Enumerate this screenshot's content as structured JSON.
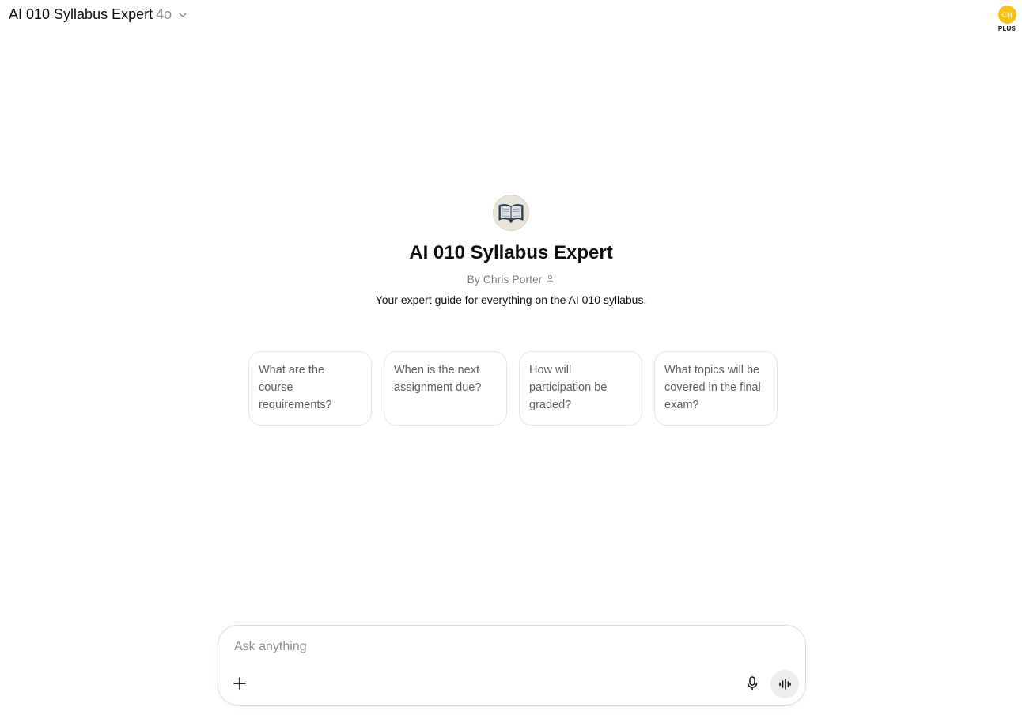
{
  "header": {
    "model_title": "AI 010 Syllabus Expert",
    "model_version": "4o",
    "chevron_icon": "chevron-down-icon",
    "account": {
      "initials": "CH",
      "plan": "PLUS",
      "avatar_color": "#f5c414"
    }
  },
  "intro": {
    "avatar_icon": "open-book-icon",
    "name": "AI 010 Syllabus Expert",
    "author": "By Chris Porter",
    "author_icon": "person-icon",
    "description": "Your expert guide for everything on the AI 010 syllabus."
  },
  "starters": [
    {
      "label": "What are the course requirements?"
    },
    {
      "label": "When is the next assignment due?"
    },
    {
      "label": "How will participation be graded?"
    },
    {
      "label": "What topics will be covered in the final exam?"
    }
  ],
  "composer": {
    "placeholder": "Ask anything",
    "value": "",
    "icons": [
      "plus-icon",
      "microphone-icon",
      "voice-mode-icon"
    ]
  },
  "colors": {
    "text": "#0d0d0d",
    "muted": "#8f8f8f",
    "card_border": "#e5e5e5",
    "voice_button_bg": "#ececec"
  }
}
